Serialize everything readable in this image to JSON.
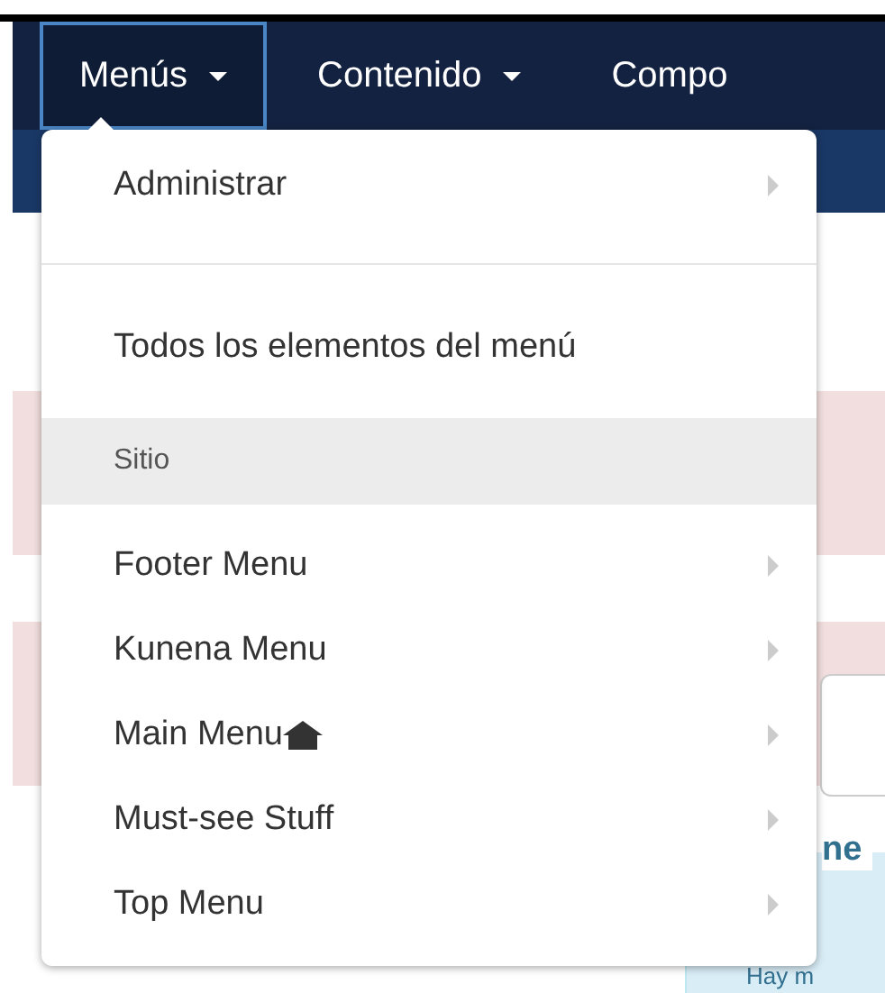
{
  "navbar": {
    "items": [
      {
        "label": "Menús",
        "selected": true,
        "caret": true
      },
      {
        "label": "Contenido",
        "selected": false,
        "caret": true
      },
      {
        "label": "Compo",
        "selected": false,
        "caret": false
      }
    ]
  },
  "dropdown": {
    "items": [
      {
        "kind": "submenu",
        "label": "Administrar",
        "home": false
      },
      {
        "kind": "divider"
      },
      {
        "kind": "link",
        "label": "Todos los elementos del menú"
      },
      {
        "kind": "header",
        "label": "Sitio"
      },
      {
        "kind": "submenu",
        "label": "Footer Menu",
        "home": false
      },
      {
        "kind": "submenu",
        "label": "Kunena Menu",
        "home": false
      },
      {
        "kind": "submenu",
        "label": "Main Menu",
        "home": true
      },
      {
        "kind": "submenu",
        "label": "Must-see Stuff",
        "home": false
      },
      {
        "kind": "submenu",
        "label": "Top Menu",
        "home": false
      }
    ]
  },
  "info_alert": {
    "title": "ne",
    "text": "Hay m"
  }
}
